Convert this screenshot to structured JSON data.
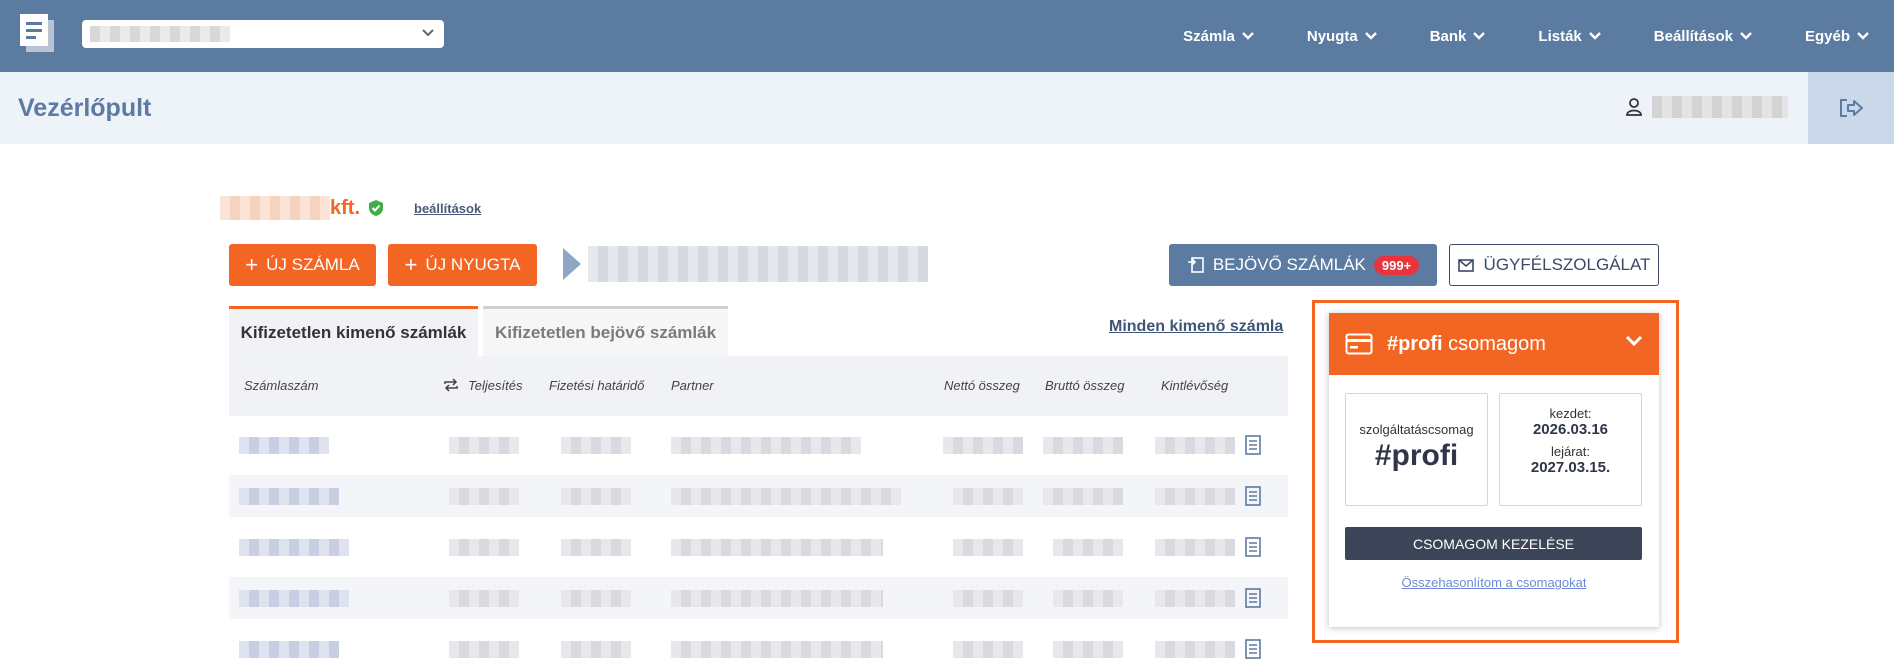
{
  "nav": {
    "items": [
      {
        "label": "Számla"
      },
      {
        "label": "Nyugta"
      },
      {
        "label": "Bank"
      },
      {
        "label": "Listák"
      },
      {
        "label": "Beállítások"
      },
      {
        "label": "Egyéb"
      }
    ]
  },
  "titlebar": {
    "title": "Vezérlőpult"
  },
  "company": {
    "suffix": "kft.",
    "settings_link": "beállítások"
  },
  "actions": {
    "new_invoice": "ÚJ SZÁMLA",
    "new_receipt": "ÚJ NYUGTA",
    "incoming_invoices": "BEJÖVŐ SZÁMLÁK",
    "incoming_badge": "999+",
    "support": "ÜGYFÉLSZOLGÁLAT"
  },
  "tabs": {
    "active": "Kifizetetlen kimenő számlák",
    "inactive": "Kifizetetlen bejövő számlák",
    "all_link": "Minden kimenő számla"
  },
  "table": {
    "columns": [
      "Számlaszám",
      "Teljesítés",
      "Fizetési határidő",
      "Partner",
      "Nettó összeg",
      "Bruttó összeg",
      "Kintlévőség"
    ]
  },
  "package_card": {
    "title_bold": "#profi",
    "title_rest": " csomagom",
    "service_label": "szolgáltatáscsomag",
    "package_name": "#profi",
    "start_label": "kezdet:",
    "start_date": "2026.03.16",
    "end_label": "lejárat:",
    "end_date": "2027.03.15.",
    "manage_button": "CSOMAGOM KEZELÉSE",
    "compare_link": "Összehasonlítom a csomagokat"
  },
  "colors": {
    "nav_bg": "#5c7ba1",
    "accent_orange": "#f26522",
    "badge_red": "#e8343c"
  }
}
